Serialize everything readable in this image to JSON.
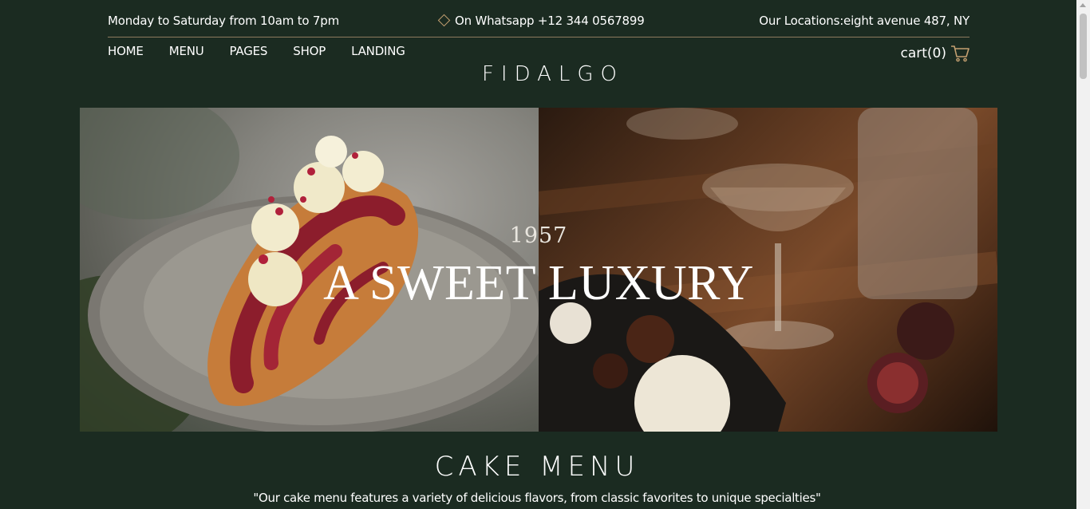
{
  "topbar": {
    "hours": "Monday to Saturday from 10am to 7pm",
    "whatsapp": "On Whatsapp +12 344 0567899",
    "location": "Our Locations:eight avenue 487, NY"
  },
  "nav": {
    "items": [
      "HOME",
      "MENU",
      "PAGES",
      "SHOP",
      "LANDING"
    ]
  },
  "brand": "FIDALGO",
  "cart": {
    "label": "cart(0)"
  },
  "hero": {
    "year": "1957",
    "title": "A SWEET LUXURY"
  },
  "cake_menu": {
    "title": "CAKE MENU",
    "description": "\"Our cake menu features a variety of delicious flavors, from classic favorites to unique specialties\""
  },
  "colors": {
    "background": "#1b2b21",
    "accent": "#c4a071",
    "divider": "#8d7a5e"
  },
  "icons": {
    "whatsapp": "diamond-icon",
    "cart": "cart-icon"
  }
}
